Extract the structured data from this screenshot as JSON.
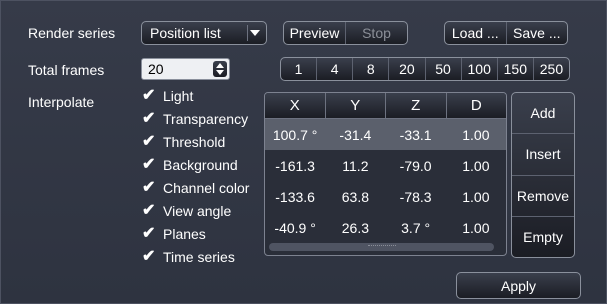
{
  "render_series": {
    "label": "Render series",
    "select_value": "Position list",
    "preview": "Preview",
    "stop": "Stop",
    "load": "Load ...",
    "save": "Save ..."
  },
  "total_frames": {
    "label": "Total frames",
    "value": "20",
    "presets": [
      "1",
      "4",
      "8",
      "20",
      "50",
      "100",
      "150",
      "250"
    ]
  },
  "interpolate": {
    "label": "Interpolate",
    "options": [
      {
        "label": "Light",
        "checked": true
      },
      {
        "label": "Transparency",
        "checked": true
      },
      {
        "label": "Threshold",
        "checked": true
      },
      {
        "label": "Background",
        "checked": true
      },
      {
        "label": "Channel color",
        "checked": true
      },
      {
        "label": "View angle",
        "checked": true
      },
      {
        "label": "Planes",
        "checked": true
      },
      {
        "label": "Time series",
        "checked": true
      }
    ]
  },
  "table": {
    "columns": [
      "X",
      "Y",
      "Z",
      "D"
    ],
    "rows": [
      [
        "100.7 °",
        "-31.4",
        "-33.1",
        "1.00"
      ],
      [
        "-161.3",
        "11.2",
        "-79.0",
        "1.00"
      ],
      [
        "-133.6",
        "63.8",
        "-78.3",
        "1.00"
      ],
      [
        "-40.9 °",
        "26.3",
        "3.7 °",
        "1.00"
      ]
    ],
    "selected_row": 0
  },
  "side_buttons": {
    "add": "Add",
    "insert": "Insert",
    "remove": "Remove",
    "empty": "Empty"
  },
  "apply": "Apply",
  "icons": {
    "dropdown": "dropdown-arrow-icon",
    "spinner": "spinner-icon",
    "check": "checkmark-icon"
  }
}
